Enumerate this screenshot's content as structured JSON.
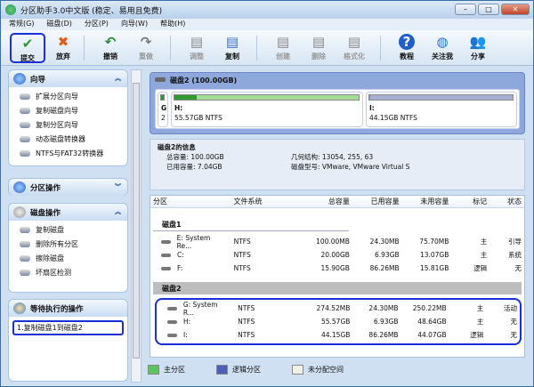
{
  "window": {
    "title": "分区助手3.0中文版 (稳定、易用且免费)",
    "min": "–",
    "max": "□",
    "close": "✕"
  },
  "menu": [
    "常规(G)",
    "磁盘(D)",
    "分区(P)",
    "向导(W)",
    "帮助(H)"
  ],
  "toolbar": [
    {
      "label": "提交",
      "icon": "check-icon",
      "glyph": "✔",
      "color": "#2a9a2a",
      "enabled": true,
      "selected": true
    },
    {
      "label": "放弃",
      "icon": "cross-icon",
      "glyph": "✖",
      "color": "#e05a1c",
      "enabled": true
    },
    {
      "label": "撤销",
      "icon": "undo-icon",
      "glyph": "↶",
      "color": "#2a8a3a",
      "enabled": true
    },
    {
      "label": "重做",
      "icon": "redo-icon",
      "glyph": "↷",
      "color": "#777",
      "enabled": false
    },
    {
      "label": "调整",
      "icon": "resize-disk-icon",
      "glyph": "▤",
      "color": "#888",
      "enabled": false
    },
    {
      "label": "复制",
      "icon": "copy-disk-icon",
      "glyph": "▤",
      "color": "#3a6fc8",
      "enabled": true
    },
    {
      "label": "创建",
      "icon": "create-partition-icon",
      "glyph": "▤",
      "color": "#888",
      "enabled": false
    },
    {
      "label": "删除",
      "icon": "delete-partition-icon",
      "glyph": "▤",
      "color": "#888",
      "enabled": false
    },
    {
      "label": "格式化",
      "icon": "format-icon",
      "glyph": "▤",
      "color": "#888",
      "enabled": false
    },
    {
      "label": "教程",
      "icon": "help-icon",
      "glyph": "?",
      "color": "#1f5fc8",
      "enabled": true
    },
    {
      "label": "关注我",
      "icon": "globe-icon",
      "glyph": "◍",
      "color": "#2a6fd0",
      "enabled": true
    },
    {
      "label": "分享",
      "icon": "users-icon",
      "glyph": "👥",
      "color": "#4a9a4a",
      "enabled": true
    }
  ],
  "sidebar": {
    "wizard": {
      "title": "向导",
      "items": [
        "扩展分区向导",
        "复制磁盘向导",
        "复制分区向导",
        "动态磁盘转换器",
        "NTFS与FAT32转换器"
      ]
    },
    "partition_ops": {
      "title": "分区操作"
    },
    "disk_ops": {
      "title": "磁盘操作",
      "items": [
        "复制磁盘",
        "删除所有分区",
        "擦除磁盘",
        "坏扇区检测"
      ]
    },
    "pending": {
      "title": "等待执行的操作",
      "items": [
        "1.复制磁盘1到磁盘2"
      ]
    }
  },
  "disk_map": {
    "title": "磁盘2 (100.00GB)",
    "partitions": [
      {
        "label": "G",
        "sub": "2",
        "used_fraction": 1.0,
        "type": "primary"
      },
      {
        "label": "H:",
        "sub": "55.57GB NTFS",
        "used_fraction": 0.12,
        "type": "primary"
      },
      {
        "label": "I:",
        "sub": "44.15GB NTFS",
        "used_fraction": 0.002,
        "type": "logical"
      }
    ]
  },
  "info": {
    "title": "磁盘2的信息",
    "total": "总容量: 100.00GB",
    "used": "已用容量: 7.04GB",
    "geometry": "几何结构: 13054, 255, 63",
    "model": "磁盘型号: VMware, VMware Virtual S"
  },
  "table": {
    "headers": [
      "分区",
      "文件系统",
      "总容量",
      "已用容量",
      "未用容量",
      "标记",
      "状态"
    ],
    "groups": [
      {
        "name": "磁盘1",
        "rows": [
          [
            "E:  System Re...",
            "NTFS",
            "100.00MB",
            "24.30MB",
            "75.70MB",
            "主",
            "引导"
          ],
          [
            "C:",
            "NTFS",
            "20.00GB",
            "6.93GB",
            "13.07GB",
            "主",
            "系统"
          ],
          [
            "F:",
            "NTFS",
            "15.90GB",
            "86.26MB",
            "15.81GB",
            "逻辑",
            "无"
          ]
        ]
      },
      {
        "name": "磁盘2",
        "rows": [
          [
            "G:  System R...",
            "NTFS",
            "274.52MB",
            "24.30MB",
            "250.22MB",
            "主",
            "活动"
          ],
          [
            "H:",
            "NTFS",
            "55.57GB",
            "6.93GB",
            "48.64GB",
            "主",
            "无"
          ],
          [
            "I:",
            "NTFS",
            "44.15GB",
            "86.26MB",
            "44.07GB",
            "逻辑",
            "无"
          ]
        ]
      }
    ]
  },
  "legend": [
    {
      "label": "主分区",
      "color": "#5ec45e"
    },
    {
      "label": "逻辑分区",
      "color": "#4a5fb8"
    },
    {
      "label": "未分配空间",
      "color": "#f2efe6"
    }
  ]
}
